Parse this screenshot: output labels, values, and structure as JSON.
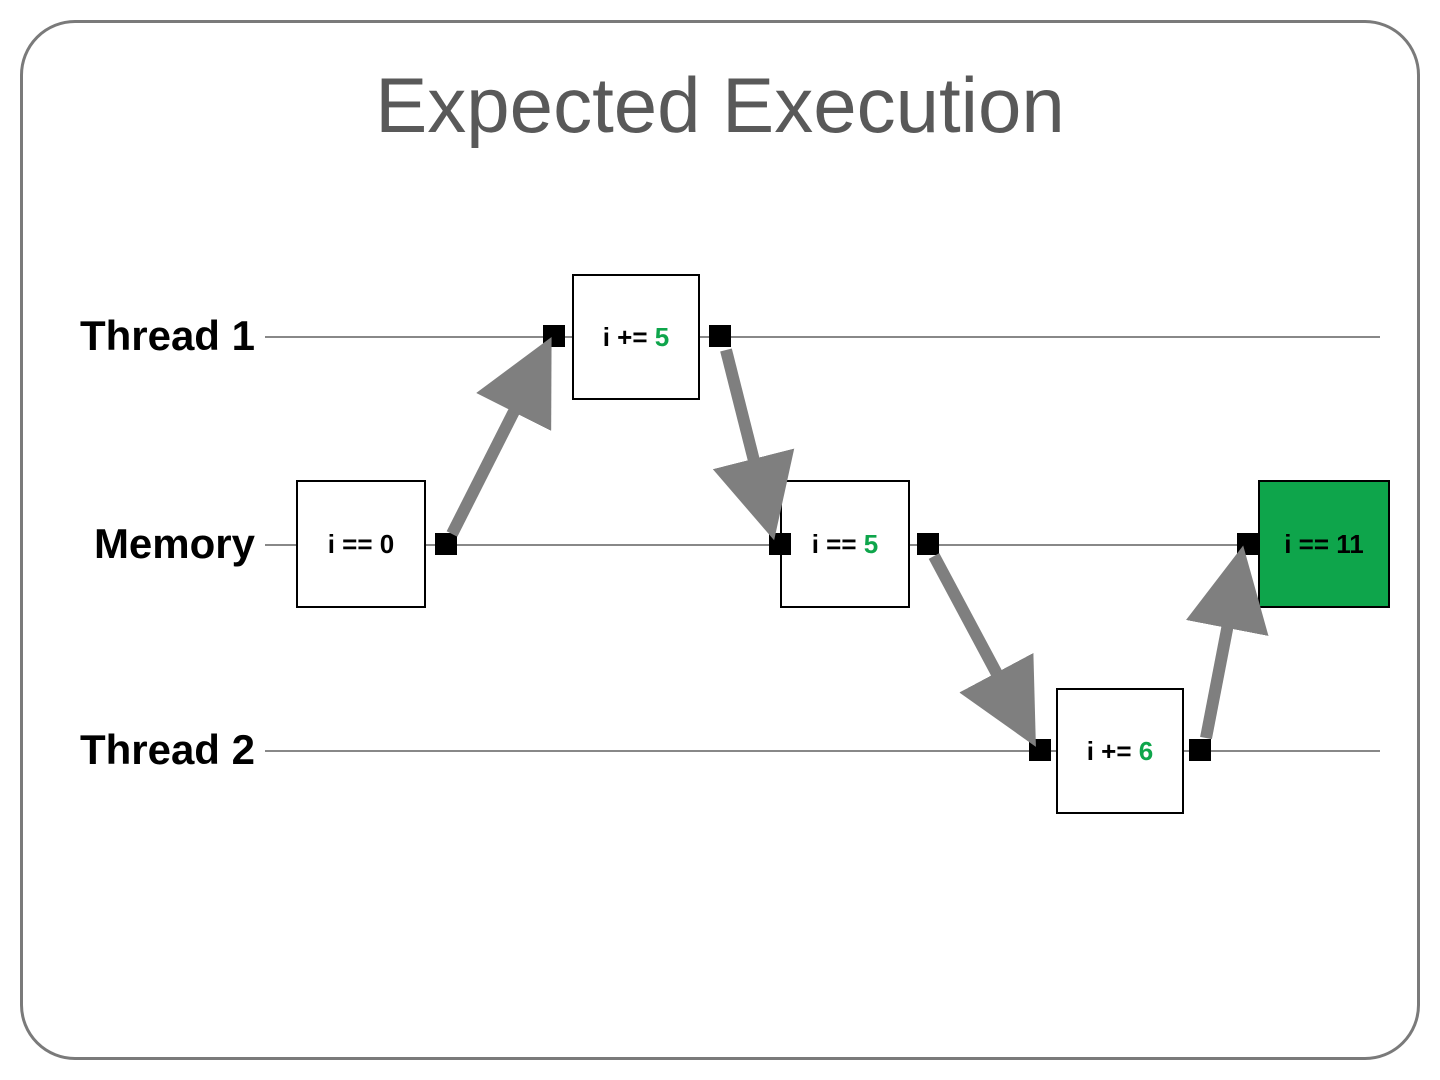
{
  "title": "Expected Execution",
  "lanes": {
    "thread1": "Thread 1",
    "memory": "Memory",
    "thread2": "Thread 2"
  },
  "boxes": {
    "mem_start": {
      "prefix": "i == ",
      "value": "0"
    },
    "t1_op": {
      "prefix": "i += ",
      "value": "5"
    },
    "mem_mid": {
      "prefix": "i == ",
      "value": "5"
    },
    "t2_op": {
      "prefix": "i += ",
      "value": "6"
    },
    "mem_end": {
      "prefix": "i == ",
      "value": "11"
    }
  }
}
